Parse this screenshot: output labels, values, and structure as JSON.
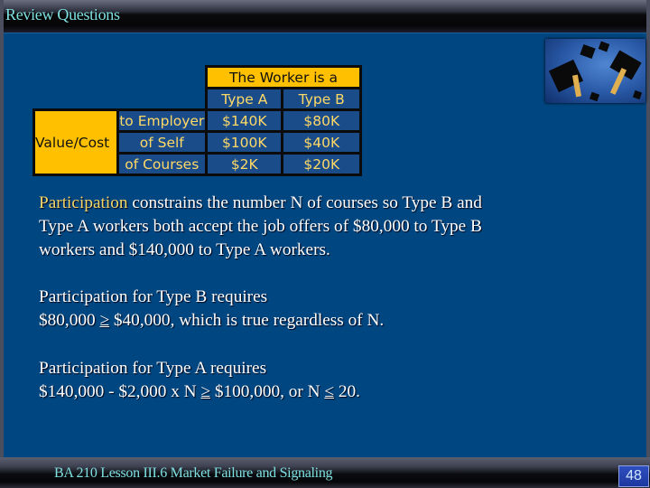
{
  "header": {
    "title": "Review Questions"
  },
  "table": {
    "group_header": "The Worker is a",
    "columns": [
      "Type A",
      "Type B"
    ],
    "row_group_label": "Value/Cost",
    "rows": [
      {
        "label": "to Employer",
        "values": [
          "$140K",
          "$80K"
        ]
      },
      {
        "label": "of Self",
        "values": [
          "$100K",
          "$40K"
        ]
      },
      {
        "label": "of Courses",
        "values": [
          "$2K",
          "$20K"
        ]
      }
    ]
  },
  "image": {
    "description": "graduation caps thrown in the air"
  },
  "paragraphs": {
    "p1_highlight": "Participation",
    "p1_rest_line1": " constrains the number N of courses so Type B and",
    "p1_line2": "Type A workers both accept the job offers of $80,000 to Type B",
    "p1_line3": "workers and $140,000 to Type A workers.",
    "p2_line1": "Participation for Type B requires",
    "p2_line2_a": "$80,000 ",
    "p2_line2_op": "≥",
    "p2_line2_b": " $40,000, which is true regardless of N.",
    "p3_line1": "Participation for Type A requires",
    "p3_line2_a": "$140,000 - $2,000 x N ",
    "p3_line2_op1": "≥",
    "p3_line2_b": " $100,000, or N ",
    "p3_line2_op2": "≤",
    "p3_line2_c": " 20."
  },
  "footer": {
    "text": "BA 210  Lesson III.6 Market Failure and Signaling",
    "page_number": "48"
  },
  "colors": {
    "background": "#004680",
    "table_header": "#ffc000",
    "table_text": "#ffd966",
    "title_text": "#7fe0e0",
    "highlight": "#f5d768"
  }
}
